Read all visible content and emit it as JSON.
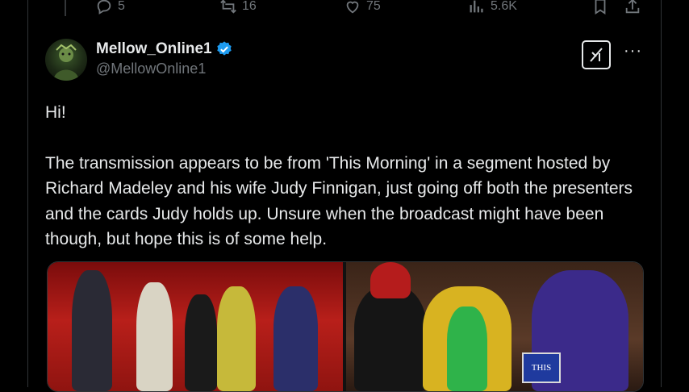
{
  "top_actions": {
    "replies": "5",
    "reposts": "16",
    "likes": "75",
    "views": "5.6K",
    "icons": [
      "reply-icon",
      "repost-icon",
      "like-icon",
      "views-icon",
      "bookmark-icon",
      "share-icon"
    ]
  },
  "post": {
    "display_name": "Mellow_Online1",
    "handle": "@MellowOnline1",
    "verified": true,
    "text_greeting": "Hi!",
    "text_body": "The transmission appears to be from 'This Morning' in a segment hosted by Richard Madeley and his wife Judy Finnigan, just going off both the presenters and the cards Judy holds up. Unsure when the broadcast might have been though, but hope this is of some help.",
    "more_label": "···",
    "media": {
      "card_text": "THIS"
    }
  },
  "colors": {
    "background": "#000000",
    "text": "#e7e9ea",
    "muted": "#71767b",
    "verified": "#1d9bf0"
  }
}
